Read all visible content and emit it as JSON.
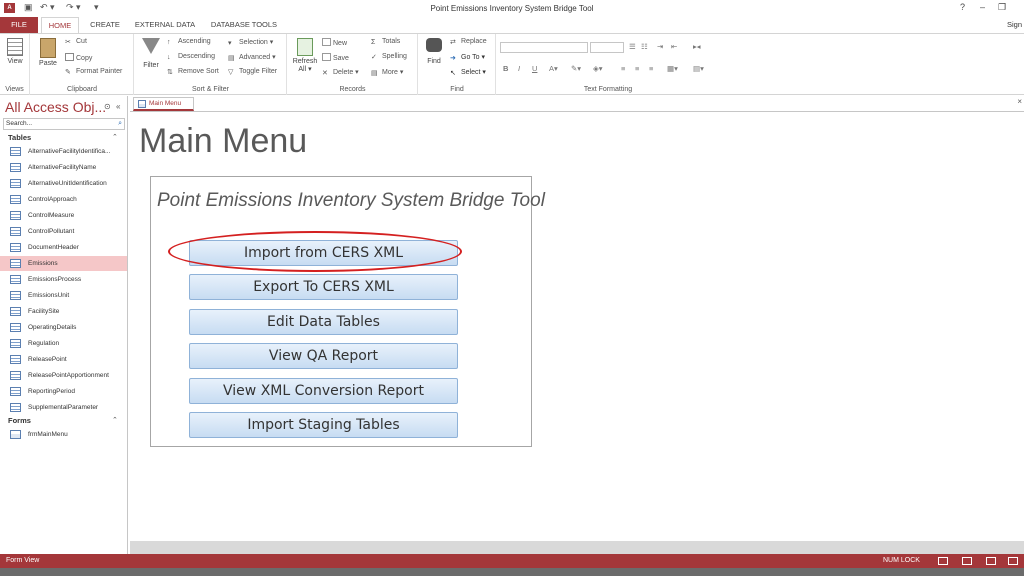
{
  "window": {
    "title": "Point Emissions Inventory System Bridge Tool",
    "app_icon": "A",
    "sign_in": "Sign",
    "help": "?",
    "restore": "❐",
    "minimize": "–",
    "qat_save": "▣",
    "qat_undo": "↶ ▾",
    "qat_redo": "↷ ▾",
    "qat_custom": "▾"
  },
  "tabs": [
    "FILE",
    "HOME",
    "CREATE",
    "EXTERNAL DATA",
    "DATABASE TOOLS"
  ],
  "ribbon": {
    "views": {
      "view": "View",
      "label": "Views"
    },
    "clipboard": {
      "paste": "Paste",
      "cut": "Cut",
      "copy": "Copy",
      "format_painter": "Format Painter",
      "label": "Clipboard"
    },
    "sort_filter": {
      "filter": "Filter",
      "ascending": "Ascending",
      "descending": "Descending",
      "remove_sort": "Remove Sort",
      "selection": "Selection ▾",
      "advanced": "Advanced ▾",
      "toggle_filter": "Toggle Filter",
      "label": "Sort & Filter"
    },
    "records": {
      "refresh": "Refresh",
      "refresh2": "All ▾",
      "new": "New",
      "save": "Save",
      "delete": "Delete ▾",
      "totals": "Totals",
      "spelling": "Spelling",
      "more": "More ▾",
      "label": "Records"
    },
    "find": {
      "find": "Find",
      "replace": "Replace",
      "goto": "Go To ▾",
      "select": "Select ▾",
      "label": "Find"
    },
    "text_formatting": {
      "bold": "B",
      "italic": "I",
      "underline": "U",
      "label": "Text Formatting"
    }
  },
  "nav": {
    "title": "All Access Obj...",
    "search_placeholder": "Search...",
    "tables_header": "Tables",
    "forms_header": "Forms",
    "tables": [
      "AlternativeFacilityIdentifica...",
      "AlternativeFacilityName",
      "AlternativeUnitIdentification",
      "ControlApproach",
      "ControlMeasure",
      "ControlPollutant",
      "DocumentHeader",
      "Emissions",
      "EmissionsProcess",
      "EmissionsUnit",
      "FacilitySite",
      "OperatingDetails",
      "Regulation",
      "ReleasePoint",
      "ReleasePointApportionment",
      "ReportingPeriod",
      "SupplementalParameter"
    ],
    "selected_table": "Emissions",
    "forms": [
      "frmMainMenu"
    ]
  },
  "document": {
    "tab_label": "Main Menu",
    "close": "×",
    "heading": "Main Menu",
    "frame_title": "Point Emissions Inventory System Bridge Tool",
    "buttons": [
      "Import from CERS XML",
      "Export To CERS XML",
      "Edit Data Tables",
      "View QA Report",
      "View XML Conversion Report",
      "Import Staging Tables"
    ],
    "highlight_color": "#d42020"
  },
  "status": {
    "left": "Form View",
    "num_lock": "NUM LOCK"
  },
  "colors": {
    "brand": "#a4373a",
    "button_fill": "#c7dcf2",
    "selected_nav": "#f5c7c8"
  }
}
